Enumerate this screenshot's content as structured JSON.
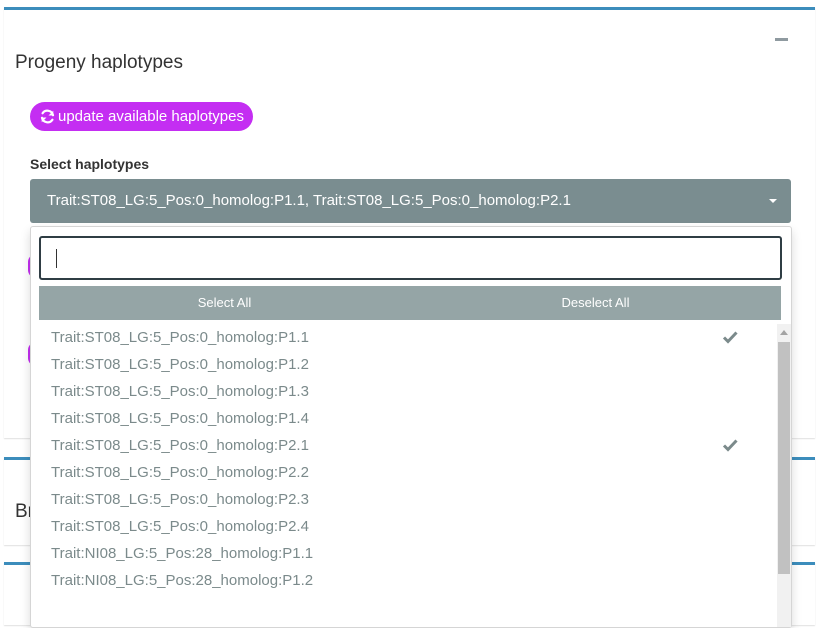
{
  "panel": {
    "title": "Progeny haplotypes",
    "update_button": "update available haplotypes",
    "select_label": "Select haplotypes",
    "selected_text": "Trait:ST08_LG:5_Pos:0_homolog:P1.1, Trait:ST08_LG:5_Pos:0_homolog:P2.1"
  },
  "dropdown": {
    "search_value": "",
    "select_all": "Select All",
    "deselect_all": "Deselect All",
    "options": [
      {
        "label": "Trait:ST08_LG:5_Pos:0_homolog:P1.1",
        "selected": true
      },
      {
        "label": "Trait:ST08_LG:5_Pos:0_homolog:P1.2",
        "selected": false
      },
      {
        "label": "Trait:ST08_LG:5_Pos:0_homolog:P1.3",
        "selected": false
      },
      {
        "label": "Trait:ST08_LG:5_Pos:0_homolog:P1.4",
        "selected": false
      },
      {
        "label": "Trait:ST08_LG:5_Pos:0_homolog:P2.1",
        "selected": true
      },
      {
        "label": "Trait:ST08_LG:5_Pos:0_homolog:P2.2",
        "selected": false
      },
      {
        "label": "Trait:ST08_LG:5_Pos:0_homolog:P2.3",
        "selected": false
      },
      {
        "label": "Trait:ST08_LG:5_Pos:0_homolog:P2.4",
        "selected": false
      },
      {
        "label": "Trait:NI08_LG:5_Pos:28_homolog:P1.1",
        "selected": false
      },
      {
        "label": "Trait:NI08_LG:5_Pos:28_homolog:P1.2",
        "selected": false
      }
    ]
  },
  "second_panel": {
    "title_partial": "Br"
  },
  "icons": {
    "update": "refresh-icon",
    "check": "check-icon",
    "collapse": "minus-icon",
    "caret": "caret-down-icon"
  },
  "colors": {
    "accent_border": "#3c8dbc",
    "update_button": "#c42ef2",
    "select_toggle": "#7a8d90",
    "actions_bar": "#95a5a6",
    "option_text": "#7b8a8b"
  }
}
